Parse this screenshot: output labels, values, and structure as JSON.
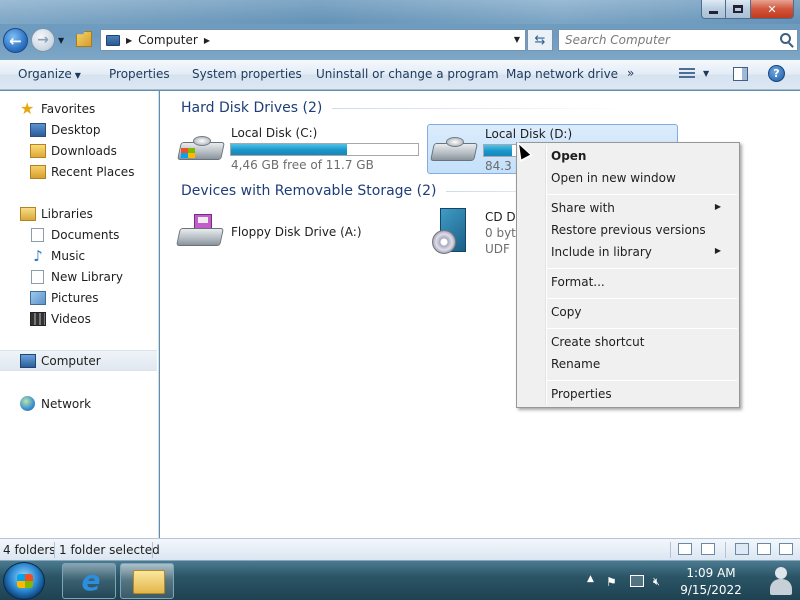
{
  "window": {
    "caption_close": "✕"
  },
  "address_bar": {
    "path_item": "Computer",
    "search_placeholder": "Search Computer"
  },
  "toolbar": {
    "organize": "Organize",
    "properties": "Properties",
    "system_properties": "System properties",
    "uninstall": "Uninstall or change a program",
    "map_network": "Map network drive",
    "more": "»",
    "help": "?"
  },
  "navpane": {
    "favorites": "Favorites",
    "desktop": "Desktop",
    "downloads": "Downloads",
    "recent_places": "Recent Places",
    "libraries": "Libraries",
    "documents": "Documents",
    "music": "Music",
    "new_library": "New Library",
    "pictures": "Pictures",
    "videos": "Videos",
    "computer": "Computer",
    "network": "Network"
  },
  "main": {
    "hdd_group": "Hard Disk Drives (2)",
    "removable_group": "Devices with Removable Storage (2)",
    "drive_c": {
      "name": "Local Disk (C:)",
      "free": "4,46 GB free of 11.7 GB",
      "used_fraction": 0.62
    },
    "drive_d": {
      "name": "Local Disk (D:)",
      "free": "84.3 M",
      "used_fraction": 0.15
    },
    "floppy": {
      "name": "Floppy Disk Drive (A:)"
    },
    "cd": {
      "name": "CD Dr",
      "free": "0 byte",
      "fs": "UDF"
    }
  },
  "context_menu": {
    "open": "Open",
    "open_new_window": "Open in new window",
    "share_with": "Share with",
    "restore_versions": "Restore previous versions",
    "include_library": "Include in library",
    "format": "Format...",
    "copy": "Copy",
    "create_shortcut": "Create shortcut",
    "rename": "Rename",
    "properties": "Properties"
  },
  "statusbar": {
    "folders": "4 folders",
    "selected": "1 folder selected"
  },
  "taskbar": {
    "time": "1:09 AM",
    "date": "9/15/2022"
  },
  "colors": {
    "accent": "#1e3d7b",
    "drive_fill": "#1b95c9",
    "taskbar": "#2b5566"
  }
}
